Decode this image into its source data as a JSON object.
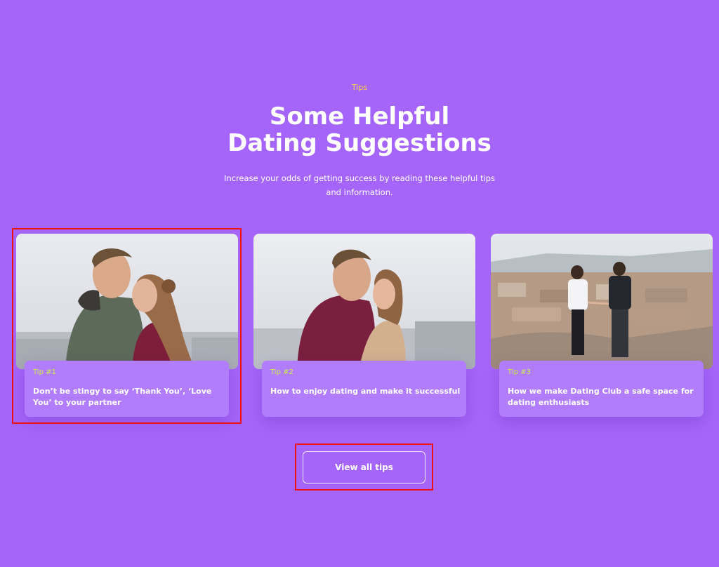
{
  "section": {
    "eyebrow": "Tips",
    "title_line1": "Some Helpful",
    "title_line2": "Dating Suggestions",
    "subtitle": "Increase your odds of getting success by reading these helpful tips and information."
  },
  "tips": [
    {
      "number": "Tip #1",
      "title": "Don’t be stingy to say ‘Thank You’, ‘Love You’ to your partner",
      "image": "couple-kissing-photo"
    },
    {
      "number": "Tip #2",
      "title": "How to enjoy dating and make it successful",
      "image": "couple-embracing-photo"
    },
    {
      "number": "Tip #3",
      "title": "How we make Dating Club a safe space for dating enthusiasts",
      "image": "couple-overlooking-city-photo"
    }
  ],
  "cta": {
    "label": "View all tips"
  },
  "colors": {
    "background": "#a565fb",
    "eyebrow": "#f6d44a",
    "tip_number": "#c8f04a",
    "highlight": "#ee1111"
  }
}
